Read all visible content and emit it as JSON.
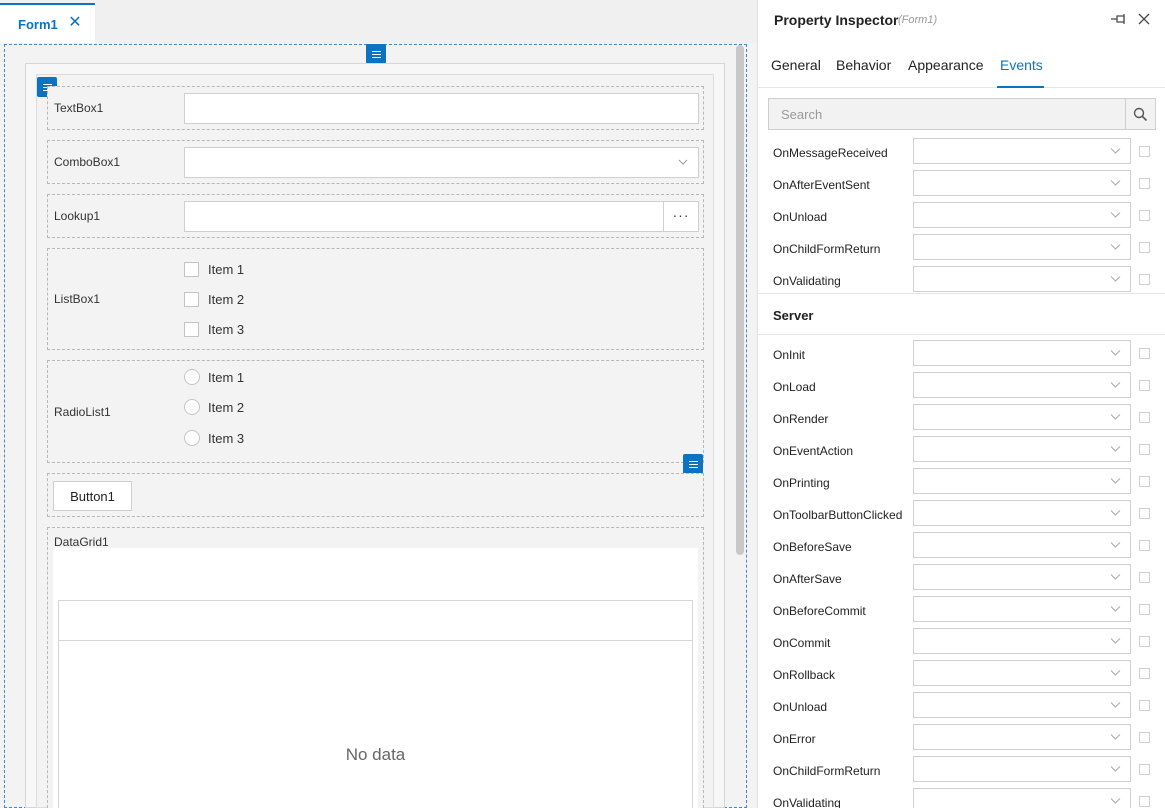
{
  "document_tab": {
    "label": "Form1"
  },
  "form": {
    "textbox": {
      "label": "TextBox1",
      "value": ""
    },
    "combobox": {
      "label": "ComboBox1",
      "value": ""
    },
    "lookup": {
      "label": "Lookup1",
      "value": "",
      "button": "···"
    },
    "listbox": {
      "label": "ListBox1",
      "items": [
        "Item 1",
        "Item 2",
        "Item 3"
      ]
    },
    "radiolist": {
      "label": "RadioList1",
      "items": [
        "Item 1",
        "Item 2",
        "Item 3"
      ]
    },
    "button": {
      "label": "Button1"
    },
    "datagrid": {
      "label": "DataGrid1",
      "empty_text": "No data"
    }
  },
  "inspector": {
    "title": "Property Inspector",
    "subtitle": "(Form1)",
    "tabs": [
      "General",
      "Behavior",
      "Appearance",
      "Events"
    ],
    "active_tab": "Events",
    "search_placeholder": "Search",
    "client_events": [
      "OnMessageReceived",
      "OnAfterEventSent",
      "OnUnload",
      "OnChildFormReturn",
      "OnValidating"
    ],
    "server_section": "Server",
    "server_events": [
      "OnInit",
      "OnLoad",
      "OnRender",
      "OnEventAction",
      "OnPrinting",
      "OnToolbarButtonClicked",
      "OnBeforeSave",
      "OnAfterSave",
      "OnBeforeCommit",
      "OnCommit",
      "OnRollback",
      "OnUnload",
      "OnError",
      "OnChildFormReturn",
      "OnValidating"
    ]
  },
  "colors": {
    "accent": "#0b73c4"
  }
}
